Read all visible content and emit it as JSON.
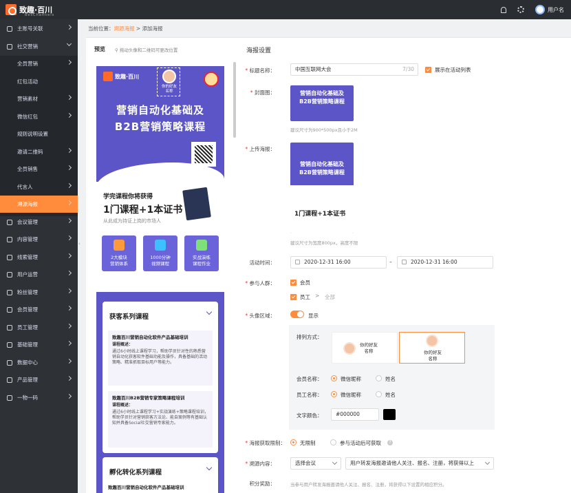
{
  "topbar": {
    "logo_text": "致趣·百川",
    "logo_sub": "BesChannels",
    "user_name": "用户名"
  },
  "sidebar": {
    "items": [
      {
        "label": "主账号关联",
        "icon": "grid-icon",
        "expanded": false
      },
      {
        "label": "社交营销",
        "icon": "sparkle-icon",
        "expanded": true
      },
      {
        "label": "全员营销",
        "sub": true,
        "chevron": true
      },
      {
        "label": "红包活动",
        "sub": true,
        "chevron": false
      },
      {
        "label": "营销素材",
        "sub": true,
        "chevron": true
      },
      {
        "label": "微信红包",
        "sub": true,
        "chevron": true
      },
      {
        "label": "规则说明设置",
        "sub": true,
        "chevron": false
      },
      {
        "label": "邀请二维码",
        "sub": true,
        "chevron": true
      },
      {
        "label": "全员销售",
        "sub": true,
        "chevron": true
      },
      {
        "label": "代言人",
        "sub": true,
        "chevron": true
      },
      {
        "label": "溯源海报",
        "sub": true,
        "chevron": true,
        "active": true
      },
      {
        "label": "会议管理",
        "icon": "monitor-icon"
      },
      {
        "label": "内容管理",
        "icon": "document-icon"
      },
      {
        "label": "线索管理",
        "icon": "funnel-icon"
      },
      {
        "label": "用户运营",
        "icon": "clock-icon"
      },
      {
        "label": "粉丝管理",
        "icon": "target-icon"
      },
      {
        "label": "会员管理",
        "icon": "lock-icon"
      },
      {
        "label": "员工管理",
        "icon": "person-icon"
      },
      {
        "label": "基础管理",
        "icon": "database-icon"
      },
      {
        "label": "数据中心",
        "icon": "bar-chart-icon"
      },
      {
        "label": "产品管理",
        "icon": "grid-icon"
      },
      {
        "label": "一物一码",
        "icon": "scan-icon"
      }
    ],
    "active_color": "#ff8b3d"
  },
  "breadcrumb": {
    "prefix": "当前位置：",
    "parent": "溯源海报",
    "sep": " > ",
    "current": "添加海报"
  },
  "preview": {
    "title": "预览",
    "tip": "拖动头像和二维码可更改位置",
    "poster": {
      "logo": "致趣·百川",
      "avatar_text": "你的好友\n名称",
      "title_line1": "营销自动化基础及",
      "title_line2": "B2B营销策略课程",
      "learn": "学完课程你将获得",
      "course_count": "1门课程+1本证书",
      "learn_sub": "从此成为持证上岗的市场人",
      "features": [
        {
          "l1": "2大模块",
          "l2": "营销体系"
        },
        {
          "l1": "1000分钟",
          "l2": "视频课程"
        },
        {
          "l1": "实战演练",
          "l2": "课程作业"
        }
      ],
      "card1_title": "获客系列课程",
      "course1": {
        "title": "致趣百川营销自动化软件产品基础培训",
        "label": "课程概述：",
        "desc": "通过6小时线上课程学习，帮助学员针对性的熟悉营销自动化获客软件基础功能及操作，具备基础的活动策略、精准抓取目标用户等能力。"
      },
      "course2": {
        "title": "致趣百川B2B营销专家策略课程培训",
        "label": "课程概述：",
        "desc": "通过6小时线上课程学习+实战演练+策略课程培训，帮助学员针对营销获客方法论、能自案例等有基础认知并具备Social社交营销专家能力。"
      },
      "card2_title": "孵化转化系列课程",
      "course3_title": "致趣百川营销自动化软件产品基础培训"
    }
  },
  "settings": {
    "section_title": "海报设置",
    "title_label": "标题名称：",
    "title_value": "中国互联网大会",
    "title_count": "7/30",
    "show_in_list": "展示在活动列表",
    "cover_label": "封面图：",
    "cover_hint": "建议尺寸为900*500px且小于2M",
    "upload_label": "上传海报：",
    "upload_hint": "建议尺寸为宽度800px，高度不限",
    "time_label": "活动时间：",
    "time_start": "2020-12-31 16:00",
    "time_sep": "–",
    "time_end": "2020-12-31 16:00",
    "participants_label": "参与人群：",
    "participant_member": "会员",
    "participant_staff": "员工",
    "participant_all": "全部",
    "avatar_area_label": "头像区域：",
    "avatar_area_toggle": "显示",
    "arrange_label": "排列方式：",
    "arrange_opt_text": "你的好友\n名称",
    "member_name_label": "会员名称：",
    "member_name_opt1": "微信昵称",
    "member_name_opt2": "姓名",
    "staff_name_label": "员工名称：",
    "staff_name_opt1": "微信昵称",
    "staff_name_opt2": "姓名",
    "text_color_label": "文字颜色：",
    "text_color_value": "#000000",
    "limit_label": "海报获取限制：",
    "limit_opt1": "无限制",
    "limit_opt2": "参与活动后可获取",
    "source_label": "溯源内容：",
    "source_select1": "选择会议",
    "source_select2": "用户转发海报邀请他人关注、报名、注册，将获得以上",
    "points_label": "积分奖励：",
    "points_hint": "当参与用户转发海报邀请他人关注、报名、注册，将获得以下设置的相应积分。"
  },
  "colors": {
    "accent": "#ff8b3d",
    "poster": "#5c55c7",
    "sidebar": "#2e3237",
    "topbar": "#2a2d32"
  }
}
